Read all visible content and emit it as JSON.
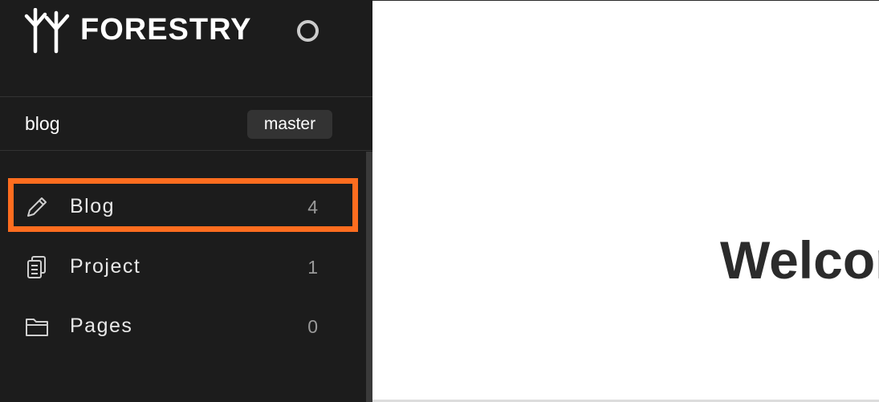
{
  "brand": {
    "name": "FORESTRY",
    "logo_icon": "forestry-tree-logo",
    "status_icon": "circle-outline-icon"
  },
  "repo": {
    "name": "blog",
    "branch": "master"
  },
  "nav": {
    "items": [
      {
        "label": "Blog",
        "count": "4",
        "icon": "pencil-icon",
        "highlighted": true
      },
      {
        "label": "Project",
        "count": "1",
        "icon": "documents-icon",
        "highlighted": false
      },
      {
        "label": "Pages",
        "count": "0",
        "icon": "folder-icon",
        "highlighted": false
      }
    ]
  },
  "main": {
    "heading": "Welcor"
  },
  "colors": {
    "sidebar_bg": "#1c1c1c",
    "highlight": "#ff6d1f",
    "badge_bg": "#333333",
    "text_muted": "#9a9a9a"
  }
}
